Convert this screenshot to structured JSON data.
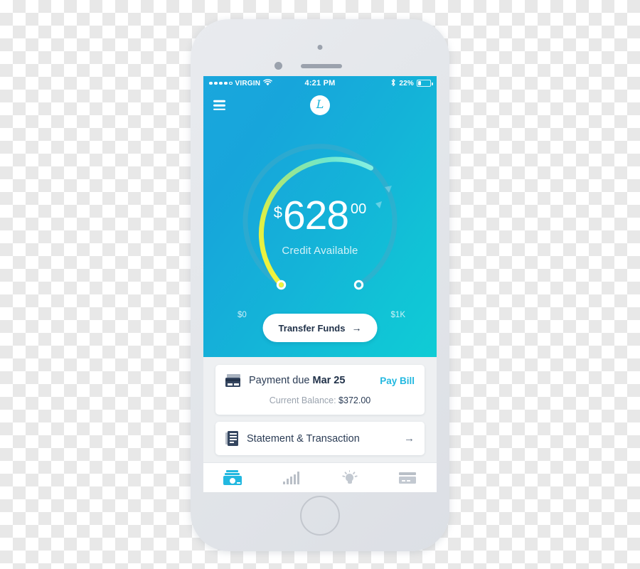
{
  "device": {
    "name": "smartphone-mockup",
    "home_button": "home-button"
  },
  "status_bar": {
    "carrier": "VIRGIN",
    "signal_dots_filled": 4,
    "signal_dots_total": 5,
    "wifi_icon": "wifi-icon",
    "time": "4:21 PM",
    "bluetooth_icon": "bluetooth-icon",
    "battery_percent": "22%",
    "battery_level": 22
  },
  "header": {
    "menu_icon": "hamburger-menu-icon",
    "logo_glyph": "L",
    "logo_name": "app-logo"
  },
  "gauge": {
    "currency_symbol": "$",
    "amount_integer": "628",
    "amount_cents": "00",
    "caption": "Credit Available",
    "min_label": "$0",
    "max_label": "$1K",
    "min_value": 0,
    "max_value": 1000,
    "current_value": 628,
    "progress_ratio": 0.628,
    "track_color": "#3aa8c6",
    "progress_gradient": [
      "#f5f03c",
      "#c8e84f",
      "#8fe39a",
      "#6fe6cf",
      "#7ff0e0"
    ],
    "transfer_button_label": "Transfer Funds",
    "transfer_button_arrow": "→"
  },
  "payment_card": {
    "icon": "credit-cards-icon",
    "label_prefix": "Payment due ",
    "due_date": "Mar 25",
    "action_label": "Pay Bill",
    "balance_label": "Current Balance: ",
    "balance_value": "$372.00"
  },
  "statement_card": {
    "icon": "document-icon",
    "label": "Statement & Transaction",
    "arrow": "→"
  },
  "tab_bar": {
    "tabs": [
      {
        "name": "tab-accounts",
        "icon": "money-icon",
        "active": true
      },
      {
        "name": "tab-insights",
        "icon": "bar-chart-icon",
        "active": false
      },
      {
        "name": "tab-tips",
        "icon": "lightbulb-icon",
        "active": false
      },
      {
        "name": "tab-cards",
        "icon": "credit-card-icon",
        "active": false
      }
    ]
  },
  "colors": {
    "accent_cyan": "#22b8e0",
    "hero_blue_start": "#1aa7dd",
    "hero_blue_end": "#0fccd5",
    "text_navy": "#2b3c55",
    "muted_gray": "#9aa3ae"
  }
}
